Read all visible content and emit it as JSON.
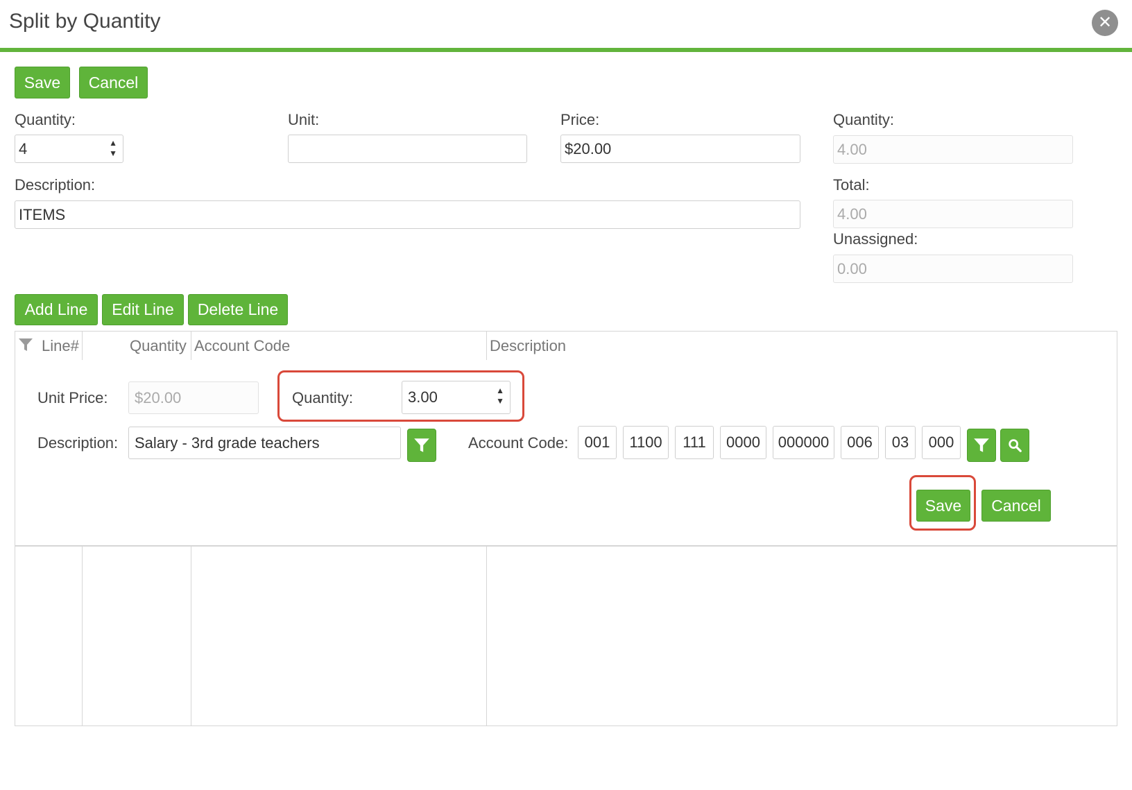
{
  "dialog": {
    "title": "Split by Quantity"
  },
  "toolbar": {
    "save_label": "Save",
    "cancel_label": "Cancel"
  },
  "form": {
    "quantity_label": "Quantity:",
    "quantity_value": "4",
    "unit_label": "Unit:",
    "unit_value": "",
    "price_label": "Price:",
    "price_value": "$20.00",
    "description_label": "Description:",
    "description_value": "ITEMS"
  },
  "summary": {
    "quantity_label": "Quantity:",
    "quantity_value": "4.00",
    "total_label": "Total:",
    "total_value": "4.00",
    "unassigned_label": "Unassigned:",
    "unassigned_value": "0.00"
  },
  "line_actions": {
    "add_label": "Add Line",
    "edit_label": "Edit Line",
    "delete_label": "Delete Line"
  },
  "grid": {
    "columns": [
      "Line#",
      "Quantity",
      "Account Code",
      "Description"
    ]
  },
  "editor": {
    "unit_price_label": "Unit Price:",
    "unit_price_value": "$20.00",
    "quantity_label": "Quantity:",
    "quantity_value": "3.00",
    "description_label": "Description:",
    "description_value": "Salary - 3rd grade teachers",
    "account_code_label": "Account Code:",
    "account_segments": [
      "001",
      "1100",
      "111",
      "0000",
      "000000",
      "006",
      "03",
      "000"
    ],
    "save_label": "Save",
    "cancel_label": "Cancel"
  },
  "icons": {
    "close": "close-icon",
    "filter": "filter-icon",
    "search": "search-icon"
  },
  "colors": {
    "accent": "#5fb43a",
    "highlight": "#d9493a"
  }
}
